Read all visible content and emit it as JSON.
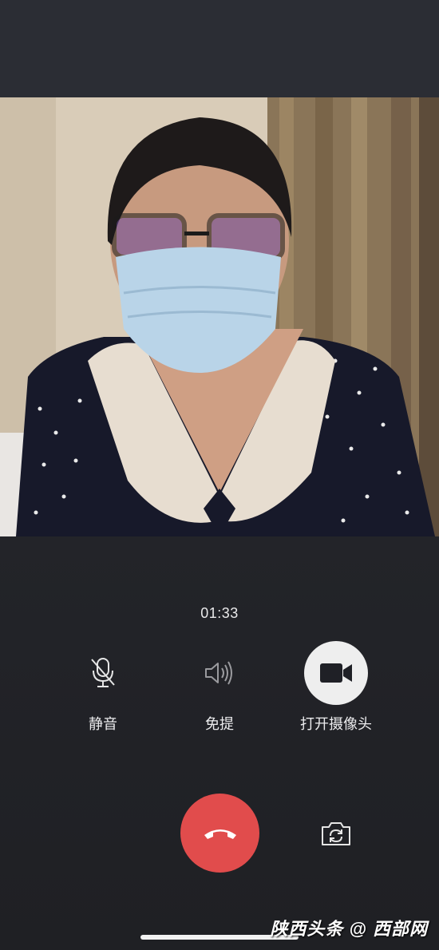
{
  "call": {
    "timer": "01:33",
    "controls": [
      {
        "label": "静音",
        "icon": "microphone-muted-icon"
      },
      {
        "label": "免提",
        "icon": "speaker-icon"
      },
      {
        "label": "打开摄像头",
        "icon": "video-camera-icon"
      }
    ],
    "hangup_icon": "phone-hangup-icon",
    "flip_icon": "camera-switch-icon"
  },
  "watermark": {
    "text": "陕西头条 @ 西部网"
  },
  "colors": {
    "background": "#232429",
    "hangup": "#e14c4c",
    "camera_button": "#eeeeee",
    "text": "#ececee"
  }
}
